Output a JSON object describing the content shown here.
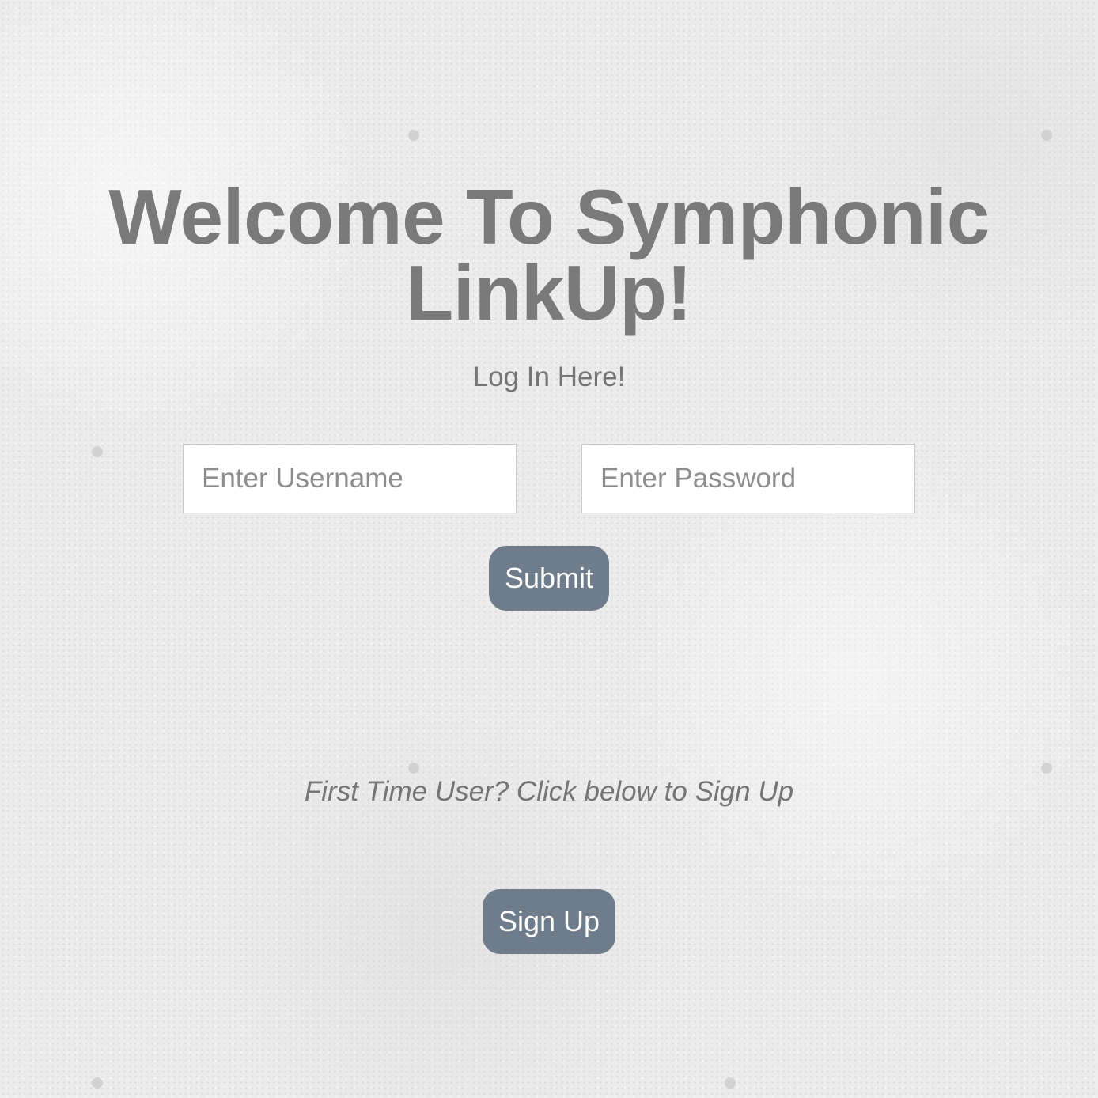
{
  "header": {
    "title": "Welcome To Symphonic LinkUp!",
    "subtitle": "Log In Here!"
  },
  "login_form": {
    "username": {
      "value": "",
      "placeholder": "Enter Username"
    },
    "password": {
      "value": "",
      "placeholder": "Enter Password"
    },
    "submit_label": "Submit"
  },
  "signup": {
    "prompt": "First Time User? Click below to Sign Up",
    "button_label": "Sign Up"
  },
  "colors": {
    "button": "#6e7c8c",
    "text": "#7a7a7a",
    "background": "#ececec"
  }
}
